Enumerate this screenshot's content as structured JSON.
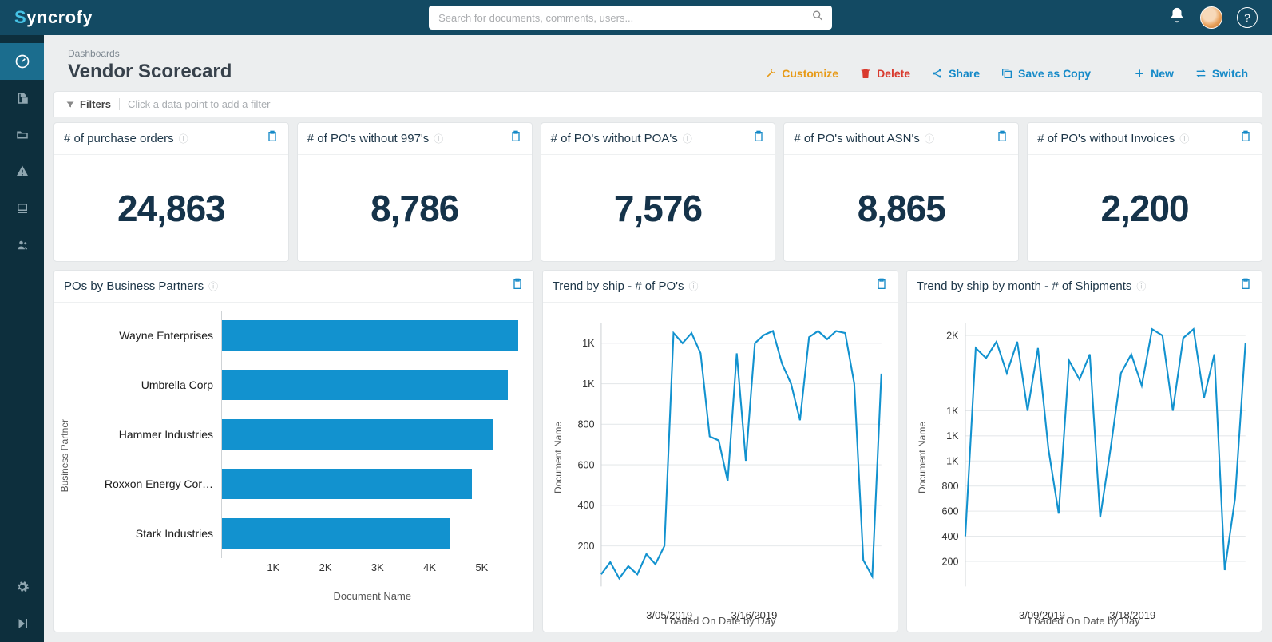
{
  "app": {
    "logo_text": "yncrofy",
    "logo_first": "S"
  },
  "search": {
    "placeholder": "Search for documents, comments, users..."
  },
  "breadcrumb": "Dashboards",
  "page_title": "Vendor Scorecard",
  "actions": {
    "customize": "Customize",
    "delete": "Delete",
    "share": "Share",
    "save_copy": "Save as Copy",
    "new": "New",
    "switch": "Switch"
  },
  "filters": {
    "label": "Filters",
    "hint": "Click a data point to add a filter"
  },
  "kpis": [
    {
      "title": "# of purchase orders",
      "value": "24,863"
    },
    {
      "title": "# of PO's without 997's",
      "value": "8,786"
    },
    {
      "title": "# of PO's without POA's",
      "value": "7,576"
    },
    {
      "title": "# of PO's without ASN's",
      "value": "8,865"
    },
    {
      "title": "# of PO's without Invoices",
      "value": "2,200"
    }
  ],
  "panels": {
    "bar": {
      "title": "POs by Business Partners",
      "ylabel": "Business Partner",
      "xlabel": "Document Name"
    },
    "line1": {
      "title": "Trend by ship - # of PO's",
      "ylabel": "Document Name",
      "xlabel": "Loaded On Date by Day"
    },
    "line2": {
      "title": "Trend by ship by month - # of Shipments",
      "ylabel": "Document Name",
      "xlabel": "Loaded On Date by Day"
    }
  },
  "chart_data": [
    {
      "id": "bar",
      "type": "bar",
      "orientation": "horizontal",
      "title": "POs by Business Partners",
      "xlabel": "Document Name",
      "ylabel": "Business Partner",
      "x_ticks": [
        "1K",
        "2K",
        "3K",
        "4K",
        "5K"
      ],
      "x_tick_values": [
        1000,
        2000,
        3000,
        4000,
        5000
      ],
      "xlim": [
        0,
        5800
      ],
      "categories": [
        "Wayne Enterprises",
        "Umbrella Corp",
        "Hammer Industries",
        "Roxxon Energy Cor…",
        "Stark Industries"
      ],
      "values": [
        5700,
        5500,
        5200,
        4800,
        4400
      ]
    },
    {
      "id": "line1",
      "type": "line",
      "title": "Trend by ship - # of PO's",
      "xlabel": "Loaded On Date by Day",
      "ylabel": "Document Name",
      "y_ticks": [
        "200",
        "400",
        "600",
        "800",
        "1K",
        "1K"
      ],
      "y_tick_values": [
        200,
        400,
        600,
        800,
        1000,
        1200
      ],
      "ylim": [
        0,
        1300
      ],
      "x_ticks": [
        "3/05/2019",
        "3/16/2019"
      ],
      "x_tick_positions": [
        0.25,
        0.55
      ],
      "values": [
        60,
        120,
        40,
        100,
        60,
        160,
        110,
        200,
        1250,
        1200,
        1250,
        1150,
        740,
        720,
        520,
        1150,
        620,
        1200,
        1240,
        1260,
        1100,
        1000,
        820,
        1230,
        1260,
        1220,
        1260,
        1250,
        1000,
        130,
        50,
        1050
      ]
    },
    {
      "id": "line2",
      "type": "line",
      "title": "Trend by ship by month - # of Shipments",
      "xlabel": "Loaded On Date by Day",
      "ylabel": "Document Name",
      "y_ticks": [
        "200",
        "400",
        "600",
        "800",
        "1K",
        "1K",
        "1K",
        "2K"
      ],
      "y_tick_values": [
        200,
        400,
        600,
        800,
        1000,
        1200,
        1400,
        2000
      ],
      "ylim": [
        0,
        2100
      ],
      "x_ticks": [
        "3/09/2019",
        "3/18/2019"
      ],
      "x_tick_positions": [
        0.28,
        0.6
      ],
      "values": [
        400,
        1900,
        1820,
        1950,
        1700,
        1950,
        1400,
        1900,
        1100,
        580,
        1800,
        1650,
        1850,
        550,
        1100,
        1700,
        1850,
        1600,
        2050,
        2000,
        1400,
        1980,
        2050,
        1500,
        1850,
        130,
        700,
        1940
      ]
    }
  ]
}
